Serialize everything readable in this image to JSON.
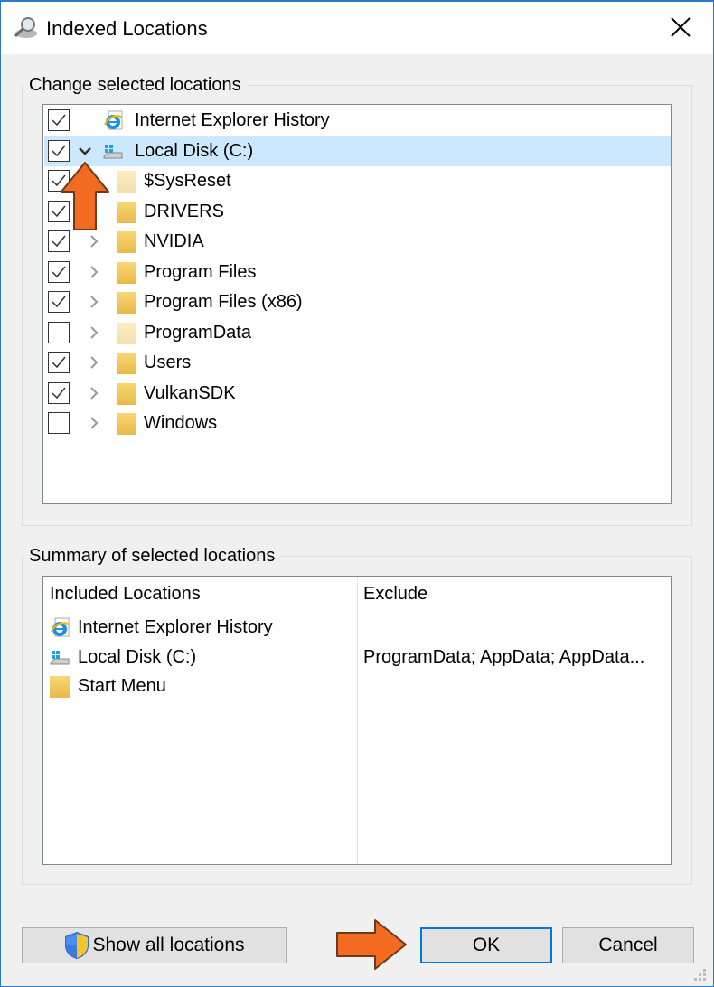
{
  "window": {
    "title": "Indexed Locations",
    "close_icon": "close-icon"
  },
  "change_group": {
    "label": "Change selected locations",
    "items": [
      {
        "label": "Internet Explorer History",
        "checked": true,
        "icon": "ie-icon",
        "level": 0,
        "expander": "none"
      },
      {
        "label": "Local Disk (C:)",
        "checked": true,
        "icon": "drive-icon",
        "level": 0,
        "expander": "expanded",
        "selected": true
      },
      {
        "label": "$SysReset",
        "checked": true,
        "icon": "folder-icon",
        "level": 1,
        "expander": "none",
        "faint": true
      },
      {
        "label": "DRIVERS",
        "checked": true,
        "icon": "folder-icon",
        "level": 1,
        "expander": "none"
      },
      {
        "label": "NVIDIA",
        "checked": true,
        "icon": "folder-icon",
        "level": 1,
        "expander": "collapsed"
      },
      {
        "label": "Program Files",
        "checked": true,
        "icon": "folder-icon",
        "level": 1,
        "expander": "collapsed"
      },
      {
        "label": "Program Files (x86)",
        "checked": true,
        "icon": "folder-icon",
        "level": 1,
        "expander": "collapsed"
      },
      {
        "label": "ProgramData",
        "checked": false,
        "icon": "folder-icon",
        "level": 1,
        "expander": "collapsed",
        "faint": true
      },
      {
        "label": "Users",
        "checked": true,
        "icon": "folder-icon",
        "level": 1,
        "expander": "collapsed"
      },
      {
        "label": "VulkanSDK",
        "checked": true,
        "icon": "folder-icon",
        "level": 1,
        "expander": "collapsed"
      },
      {
        "label": "Windows",
        "checked": false,
        "icon": "folder-icon",
        "level": 1,
        "expander": "collapsed"
      }
    ]
  },
  "summary_group": {
    "label": "Summary of selected locations",
    "columns": [
      "Included Locations",
      "Exclude"
    ],
    "rows": [
      {
        "location": "Internet Explorer History",
        "icon": "ie-icon",
        "exclude": ""
      },
      {
        "location": "Local Disk (C:)",
        "icon": "drive-icon",
        "exclude": "ProgramData; AppData; AppData..."
      },
      {
        "location": "Start Menu",
        "icon": "folder-icon",
        "exclude": ""
      }
    ]
  },
  "buttons": {
    "show_all": "Show all locations",
    "ok": "OK",
    "cancel": "Cancel"
  },
  "colors": {
    "accent": "#0078d7",
    "selection": "#cce8ff",
    "annotation_arrow": "#f26b21"
  }
}
